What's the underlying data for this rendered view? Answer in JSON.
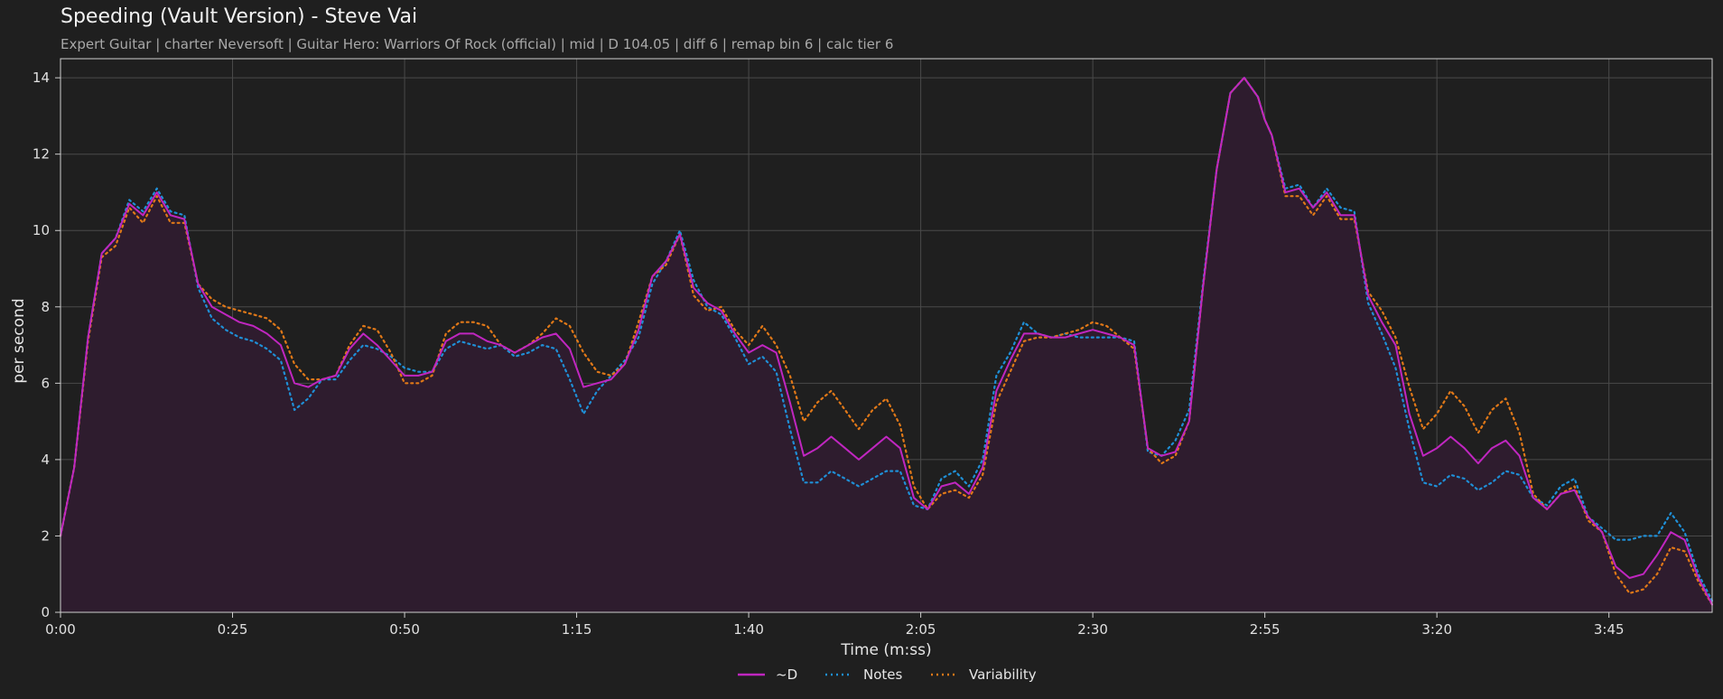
{
  "header": {
    "title": "Speeding (Vault Version) - Steve Vai",
    "subtitle": "Expert Guitar  |  charter Neversoft  |  Guitar Hero: Warriors Of Rock (official)  |  mid  |  D 104.05  |  diff 6  |  remap bin 6  |  calc tier 6"
  },
  "colors": {
    "background": "#1f1f1f",
    "grid": "#4a4a4a",
    "d": "#c026c0",
    "notes": "#1f8fd6",
    "variability": "#e07818",
    "fill": "#2e1c2e"
  },
  "chart_data": {
    "type": "line",
    "xlabel": "Time (m:ss)",
    "ylabel": "per second",
    "xlim": [
      0,
      240
    ],
    "ylim": [
      0,
      14.5
    ],
    "x_ticks": [
      0,
      25,
      50,
      75,
      100,
      125,
      150,
      175,
      200,
      225
    ],
    "x_tick_labels": [
      "0:00",
      "0:25",
      "0:50",
      "1:15",
      "1:40",
      "2:05",
      "2:30",
      "2:55",
      "3:20",
      "3:45"
    ],
    "y_ticks": [
      0,
      2,
      4,
      6,
      8,
      10,
      12,
      14
    ],
    "y_tick_labels": [
      "0",
      "2",
      "4",
      "6",
      "8",
      "10",
      "12",
      "14"
    ],
    "grid": true,
    "legend_position": "bottom-center",
    "series": [
      {
        "name": "~D",
        "style": "solid",
        "x": [
          0,
          2,
          4,
          6,
          8,
          10,
          12,
          14,
          16,
          18,
          20,
          22,
          24,
          26,
          28,
          30,
          32,
          34,
          36,
          38,
          40,
          42,
          44,
          46,
          48,
          50,
          52,
          54,
          56,
          58,
          60,
          62,
          64,
          66,
          68,
          70,
          72,
          74,
          76,
          78,
          80,
          82,
          84,
          86,
          88,
          90,
          92,
          94,
          96,
          98,
          100,
          102,
          104,
          106,
          108,
          110,
          112,
          114,
          116,
          118,
          120,
          122,
          124,
          126,
          128,
          130,
          132,
          134,
          136,
          138,
          140,
          142,
          144,
          146,
          148,
          150,
          152,
          154,
          156,
          158,
          160,
          162,
          164,
          166,
          168,
          170,
          172,
          174,
          175,
          176,
          178,
          180,
          182,
          184,
          186,
          188,
          190,
          192,
          194,
          196,
          198,
          200,
          202,
          204,
          206,
          208,
          210,
          212,
          214,
          216,
          218,
          220,
          222,
          224,
          226,
          228,
          230,
          232,
          234,
          236,
          238,
          240
        ],
        "y": [
          2.0,
          3.8,
          7.2,
          9.4,
          9.8,
          10.7,
          10.4,
          11.0,
          10.4,
          10.3,
          8.6,
          8.0,
          7.8,
          7.6,
          7.5,
          7.3,
          7.0,
          6.0,
          5.9,
          6.1,
          6.2,
          6.9,
          7.3,
          7.0,
          6.6,
          6.2,
          6.2,
          6.3,
          7.1,
          7.3,
          7.3,
          7.1,
          7.0,
          6.8,
          7.0,
          7.2,
          7.3,
          6.9,
          5.9,
          6.0,
          6.1,
          6.5,
          7.4,
          8.8,
          9.2,
          9.9,
          8.5,
          8.1,
          7.9,
          7.3,
          6.8,
          7.0,
          6.8,
          5.5,
          4.1,
          4.3,
          4.6,
          4.3,
          4.0,
          4.3,
          4.6,
          4.3,
          3.0,
          2.7,
          3.3,
          3.4,
          3.1,
          3.8,
          5.8,
          6.6,
          7.3,
          7.3,
          7.2,
          7.2,
          7.3,
          7.4,
          7.3,
          7.2,
          7.0,
          4.3,
          4.1,
          4.2,
          5.0,
          8.5,
          11.6,
          13.6,
          14.0,
          13.5,
          12.9,
          12.5,
          11.0,
          11.1,
          10.6,
          11.0,
          10.4,
          10.4,
          8.3,
          7.6,
          7.0,
          5.2,
          4.1,
          4.3,
          4.6,
          4.3,
          3.9,
          4.3,
          4.5,
          4.1,
          3.0,
          2.7,
          3.1,
          3.2,
          2.5,
          2.1,
          1.2,
          0.9,
          1.0,
          1.5,
          2.1,
          1.9,
          0.9,
          0.2
        ]
      },
      {
        "name": "Notes",
        "style": "dotted",
        "x": [
          0,
          2,
          4,
          6,
          8,
          10,
          12,
          14,
          16,
          18,
          20,
          22,
          24,
          26,
          28,
          30,
          32,
          34,
          36,
          38,
          40,
          42,
          44,
          46,
          48,
          50,
          52,
          54,
          56,
          58,
          60,
          62,
          64,
          66,
          68,
          70,
          72,
          74,
          76,
          78,
          80,
          82,
          84,
          86,
          88,
          90,
          92,
          94,
          96,
          98,
          100,
          102,
          104,
          106,
          108,
          110,
          112,
          114,
          116,
          118,
          120,
          122,
          124,
          126,
          128,
          130,
          132,
          134,
          136,
          138,
          140,
          142,
          144,
          146,
          148,
          150,
          152,
          154,
          156,
          158,
          160,
          162,
          164,
          166,
          168,
          170,
          172,
          174,
          175,
          176,
          178,
          180,
          182,
          184,
          186,
          188,
          190,
          192,
          194,
          196,
          198,
          200,
          202,
          204,
          206,
          208,
          210,
          212,
          214,
          216,
          218,
          220,
          222,
          224,
          226,
          228,
          230,
          232,
          234,
          236,
          238,
          240
        ],
        "y": [
          2.0,
          3.8,
          7.2,
          9.4,
          9.8,
          10.8,
          10.5,
          11.1,
          10.5,
          10.4,
          8.5,
          7.7,
          7.4,
          7.2,
          7.1,
          6.9,
          6.6,
          5.3,
          5.6,
          6.1,
          6.1,
          6.6,
          7.0,
          6.9,
          6.7,
          6.4,
          6.3,
          6.3,
          6.9,
          7.1,
          7.0,
          6.9,
          7.0,
          6.7,
          6.8,
          7.0,
          6.9,
          6.1,
          5.2,
          5.8,
          6.2,
          6.6,
          7.2,
          8.6,
          9.2,
          10.0,
          8.7,
          8.0,
          7.8,
          7.2,
          6.5,
          6.7,
          6.3,
          4.8,
          3.4,
          3.4,
          3.7,
          3.5,
          3.3,
          3.5,
          3.7,
          3.7,
          2.8,
          2.7,
          3.5,
          3.7,
          3.3,
          4.0,
          6.2,
          6.8,
          7.6,
          7.3,
          7.2,
          7.3,
          7.2,
          7.2,
          7.2,
          7.2,
          7.1,
          4.2,
          4.1,
          4.5,
          5.3,
          8.6,
          11.6,
          13.6,
          14.0,
          13.5,
          12.9,
          12.5,
          11.1,
          11.2,
          10.6,
          11.1,
          10.6,
          10.5,
          8.1,
          7.3,
          6.4,
          4.8,
          3.4,
          3.3,
          3.6,
          3.5,
          3.2,
          3.4,
          3.7,
          3.6,
          3.0,
          2.8,
          3.3,
          3.5,
          2.5,
          2.2,
          1.9,
          1.9,
          2.0,
          2.0,
          2.6,
          2.1,
          1.0,
          0.3
        ]
      },
      {
        "name": "Variability",
        "style": "dotted",
        "x": [
          0,
          2,
          4,
          6,
          8,
          10,
          12,
          14,
          16,
          18,
          20,
          22,
          24,
          26,
          28,
          30,
          32,
          34,
          36,
          38,
          40,
          42,
          44,
          46,
          48,
          50,
          52,
          54,
          56,
          58,
          60,
          62,
          64,
          66,
          68,
          70,
          72,
          74,
          76,
          78,
          80,
          82,
          84,
          86,
          88,
          90,
          92,
          94,
          96,
          98,
          100,
          102,
          104,
          106,
          108,
          110,
          112,
          114,
          116,
          118,
          120,
          122,
          124,
          126,
          128,
          130,
          132,
          134,
          136,
          138,
          140,
          142,
          144,
          146,
          148,
          150,
          152,
          154,
          156,
          158,
          160,
          162,
          164,
          166,
          168,
          170,
          172,
          174,
          175,
          176,
          178,
          180,
          182,
          184,
          186,
          188,
          190,
          192,
          194,
          196,
          198,
          200,
          202,
          204,
          206,
          208,
          210,
          212,
          214,
          216,
          218,
          220,
          222,
          224,
          226,
          228,
          230,
          232,
          234,
          236,
          238,
          240
        ],
        "y": [
          2.0,
          3.8,
          7.1,
          9.3,
          9.6,
          10.6,
          10.2,
          10.9,
          10.2,
          10.2,
          8.6,
          8.2,
          8.0,
          7.9,
          7.8,
          7.7,
          7.4,
          6.5,
          6.1,
          6.1,
          6.2,
          7.0,
          7.5,
          7.4,
          6.8,
          6.0,
          6.0,
          6.2,
          7.3,
          7.6,
          7.6,
          7.5,
          7.0,
          6.8,
          7.0,
          7.3,
          7.7,
          7.5,
          6.8,
          6.3,
          6.2,
          6.5,
          7.6,
          8.8,
          9.1,
          9.9,
          8.3,
          7.9,
          8.0,
          7.4,
          7.0,
          7.5,
          7.0,
          6.2,
          5.0,
          5.5,
          5.8,
          5.3,
          4.8,
          5.3,
          5.6,
          4.9,
          3.3,
          2.7,
          3.1,
          3.2,
          3.0,
          3.6,
          5.5,
          6.3,
          7.1,
          7.2,
          7.2,
          7.3,
          7.4,
          7.6,
          7.5,
          7.2,
          6.9,
          4.3,
          3.9,
          4.1,
          5.0,
          8.5,
          11.6,
          13.6,
          14.0,
          13.5,
          12.9,
          12.5,
          10.9,
          10.9,
          10.4,
          10.9,
          10.3,
          10.3,
          8.4,
          7.9,
          7.2,
          5.9,
          4.8,
          5.2,
          5.8,
          5.4,
          4.7,
          5.3,
          5.6,
          4.7,
          3.1,
          2.7,
          3.1,
          3.3,
          2.4,
          2.1,
          1.0,
          0.5,
          0.6,
          1.0,
          1.7,
          1.6,
          0.8,
          0.2
        ]
      }
    ]
  }
}
